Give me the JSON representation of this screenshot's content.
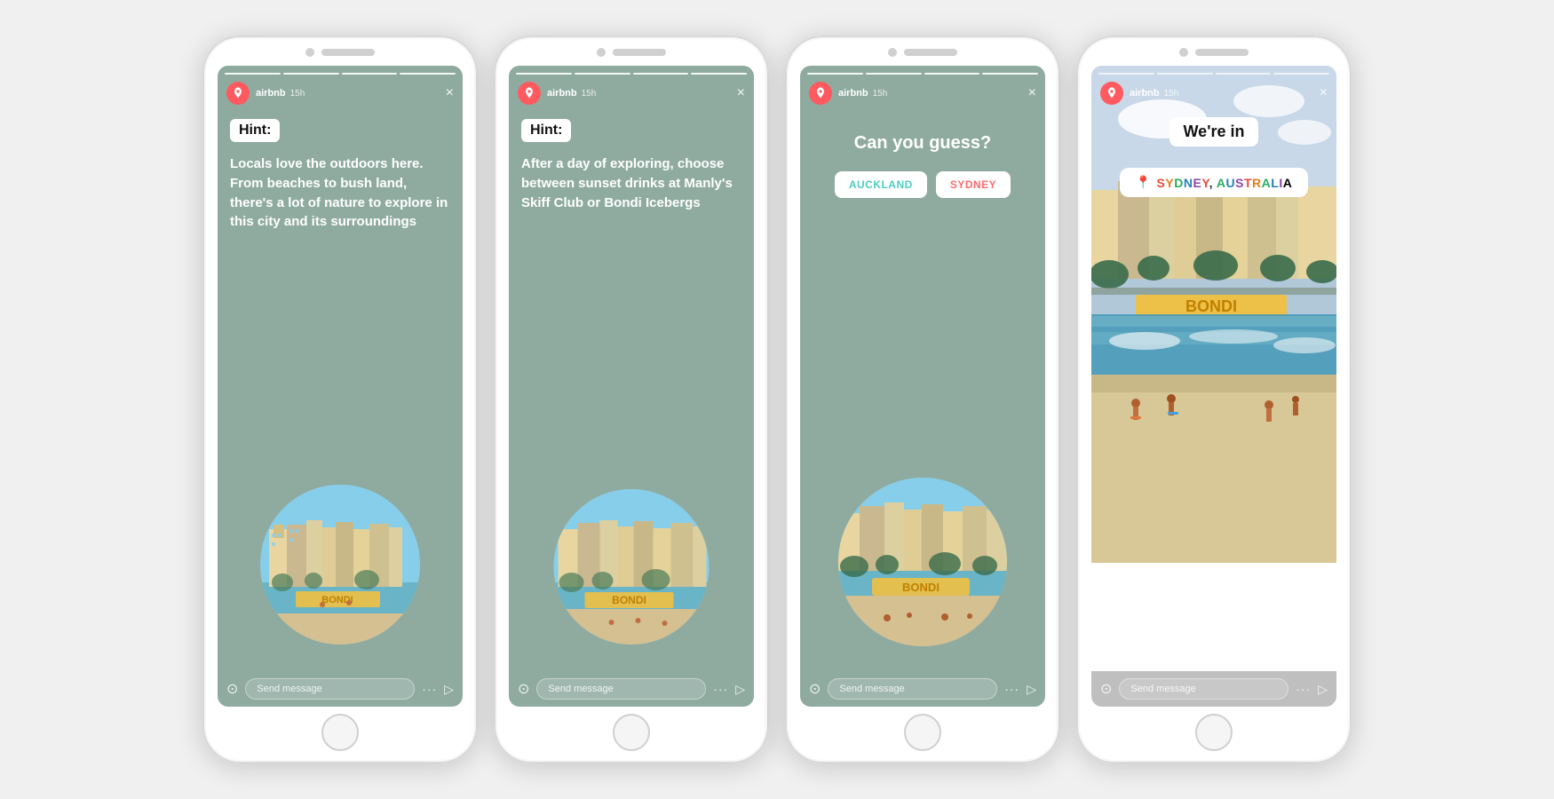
{
  "phones": [
    {
      "id": "phone-1",
      "screen_bg": "sage",
      "header": {
        "username": "airbnb",
        "time": "15h"
      },
      "progress_bars": [
        1,
        1,
        1,
        1
      ],
      "content": {
        "type": "hint-text",
        "badge": "Hint:",
        "text": "Locals love the outdoors here. From beaches to bush land, there's a lot of nature to explore in this city and its surroundings"
      },
      "bottom_bar": {
        "message_placeholder": "Send message"
      }
    },
    {
      "id": "phone-2",
      "screen_bg": "sage",
      "header": {
        "username": "airbnb",
        "time": "15h"
      },
      "progress_bars": [
        1,
        1,
        1,
        1
      ],
      "content": {
        "type": "hint-text",
        "badge": "Hint:",
        "text": "After a day of exploring, choose between sunset drinks at Manly's Skiff Club or Bondi Icebergs"
      },
      "bottom_bar": {
        "message_placeholder": "Send message"
      }
    },
    {
      "id": "phone-3",
      "screen_bg": "sage",
      "header": {
        "username": "airbnb",
        "time": "15h"
      },
      "progress_bars": [
        1,
        1,
        1,
        1
      ],
      "content": {
        "type": "quiz",
        "question": "Can you guess?",
        "options": [
          {
            "label": "AUCKLAND",
            "color": "#4ecdc4"
          },
          {
            "label": "SYDNEY",
            "color": "#ff6b6b"
          }
        ]
      },
      "bottom_bar": {
        "message_placeholder": "Send message"
      }
    },
    {
      "id": "phone-4",
      "screen_bg": "photo",
      "header": {
        "username": "airbnb",
        "time": "15h"
      },
      "progress_bars": [
        1,
        1,
        1,
        1
      ],
      "content": {
        "type": "reveal",
        "title": "We're in",
        "location": "SYDNEY, AUSTRALIA",
        "location_letters": [
          "S",
          "Y",
          "D",
          "N",
          "E",
          "Y",
          ",",
          " ",
          "A",
          "U",
          "S",
          "T",
          "R",
          "A",
          "L",
          "I",
          "A"
        ]
      },
      "bottom_bar": {
        "message_placeholder": "Send message"
      }
    }
  ],
  "airbnb_icon": "♦",
  "close_icon": "×",
  "camera_icon": "⊙",
  "send_icon": "▷",
  "dots_icon": "···",
  "pin_icon": "📍"
}
